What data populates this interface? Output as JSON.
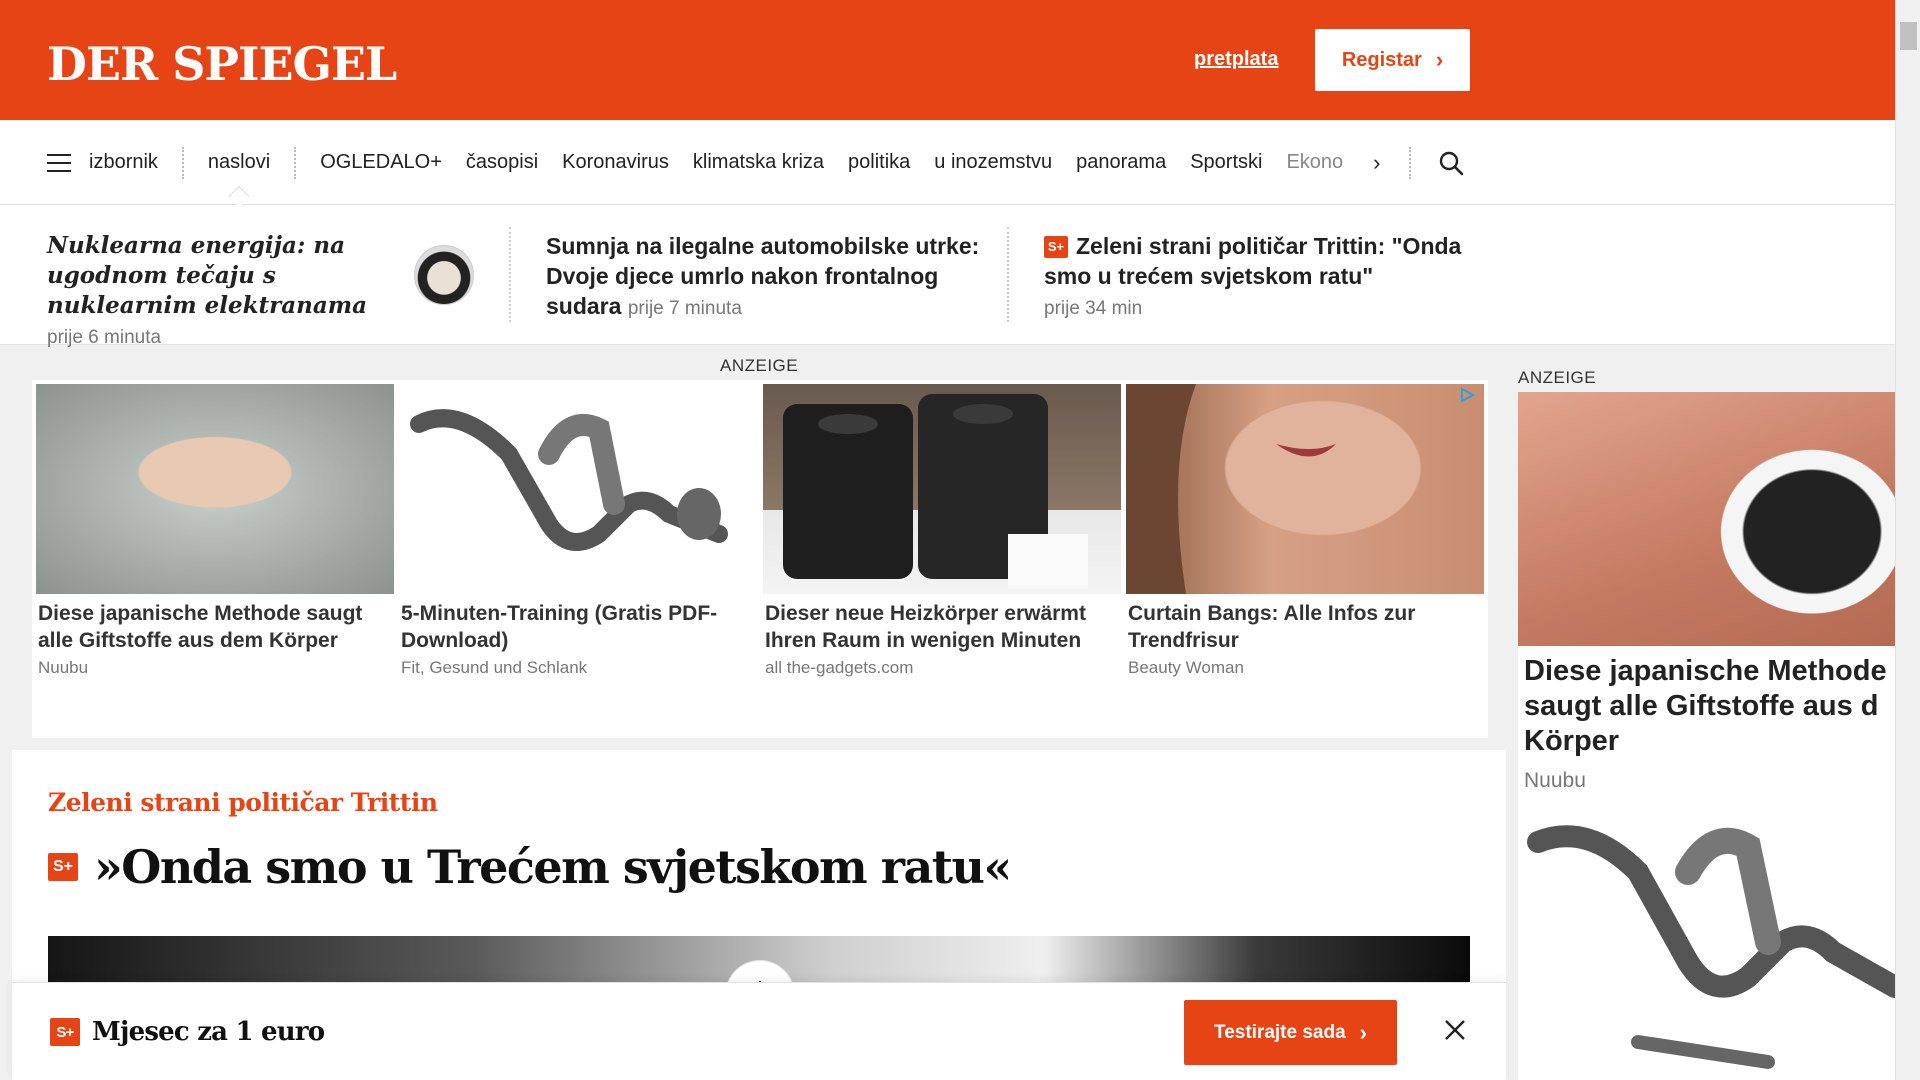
{
  "header": {
    "logo": "DER SPIEGEL",
    "subscribe_label": "pretplata",
    "register_label": "Registar",
    "brand_color": "#e64415"
  },
  "nav": {
    "menu_label": "izbornik",
    "items": [
      "naslovi",
      "OGLEDALO+",
      "časopisi",
      "Koronavirus",
      "klimatska kriza",
      "politika",
      "u inozemstvu",
      "panorama",
      "Sportski",
      "Ekono"
    ],
    "more_icon": "chevron-right-icon",
    "search_icon": "search-icon"
  },
  "teasers": [
    {
      "title": "Nuklearna energija: na ugodnom tečaju s nuklearnim elektranama",
      "time": "prije 6 minuta"
    },
    {
      "title": "Sumnja na ilegalne automobilske utrke: Dvoje djece umrlo nakon frontalnog sudara",
      "time": "prije 7 minuta"
    },
    {
      "badge": "S+",
      "title": "Zeleni strani političar Trittin: \"Onda smo u trećem svjetskom ratu\"",
      "time": "prije 34 min"
    }
  ],
  "ads": {
    "label": "ANZEIGE",
    "cards": [
      {
        "title": "Diese japanische Methode saugt alle Giftstoffe aus dem Körper",
        "source": "Nuubu"
      },
      {
        "title": "5-Minuten-Training (Gratis PDF-Download)",
        "source": "Fit, Gesund und Schlank"
      },
      {
        "title": "Dieser neue Heizkörper erwärmt Ihren Raum in wenigen Minuten",
        "source": "all the-gadgets.com"
      },
      {
        "title": "Curtain Bangs: Alle Infos zur Trendfrisur",
        "source": "Beauty Woman"
      }
    ]
  },
  "rail": {
    "label": "ANZEIGE",
    "title": "Diese japanische Methode saugt alle Giftstoffe aus d Körper",
    "title_line1": "Diese japanische Methode",
    "title_line2": "saugt alle Giftstoffe aus d",
    "title_line3": "Körper",
    "source": "Nuubu"
  },
  "article": {
    "kicker": "Zeleni strani političar Trittin",
    "badge": "S+",
    "headline": "»Onda smo u Trećem svjetskom ratu«"
  },
  "promo": {
    "badge": "S+",
    "text": "Mjesec za 1 euro",
    "button_label": "Testirajte sada"
  }
}
